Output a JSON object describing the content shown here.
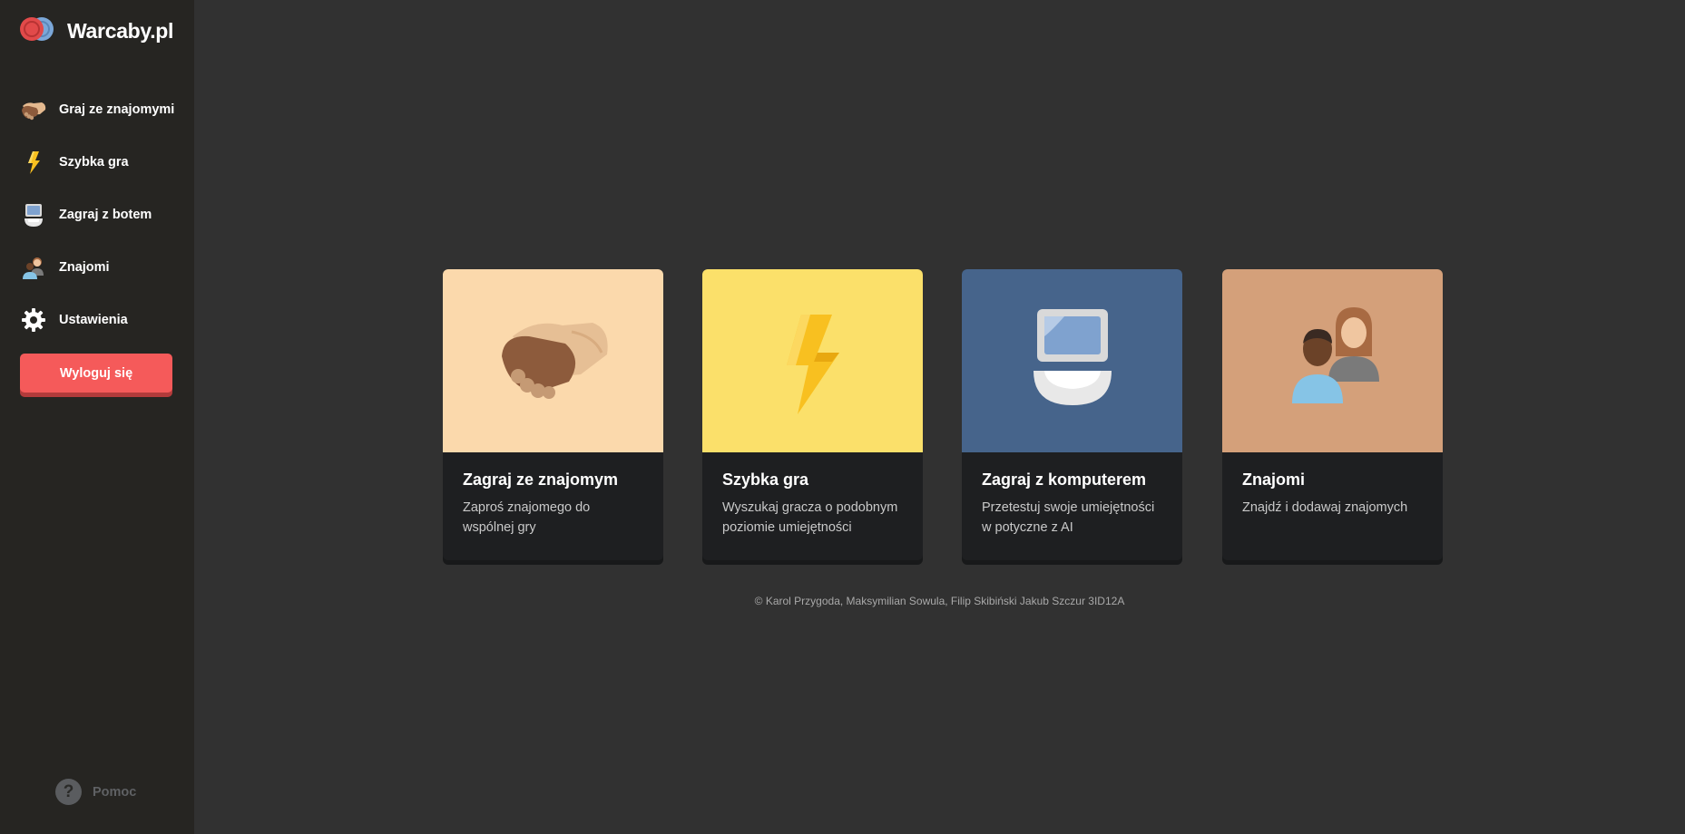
{
  "app": {
    "name": "Warcaby.pl"
  },
  "colors": {
    "accent": "#f55a5a",
    "sidebar": "#262522",
    "background": "#313131"
  },
  "sidebar": {
    "items": [
      {
        "label": "Graj ze znajomymi",
        "icon": "handshake-icon"
      },
      {
        "label": "Szybka gra",
        "icon": "lightning-icon"
      },
      {
        "label": "Zagraj z botem",
        "icon": "computer-icon"
      },
      {
        "label": "Znajomi",
        "icon": "friends-icon"
      },
      {
        "label": "Ustawienia",
        "icon": "gear-icon"
      }
    ],
    "logout_label": "Wyloguj się",
    "help_label": "Pomoc",
    "help_glyph": "?"
  },
  "cards": [
    {
      "title": "Zagraj ze znajomym",
      "description": "Zaproś znajomego do wspólnej gry",
      "icon": "handshake-icon",
      "color": "#fbd9ac"
    },
    {
      "title": "Szybka gra",
      "description": "Wyszukaj gracza o podobnym poziomie umiejętności",
      "icon": "lightning-icon",
      "color": "#fbe06a"
    },
    {
      "title": "Zagraj z komputerem",
      "description": "Przetestuj swoje umiejętności w potyczne z AI",
      "icon": "computer-icon",
      "color": "#46648b"
    },
    {
      "title": "Znajomi",
      "description": "Znajdź i dodawaj znajomych",
      "icon": "friends-icon",
      "color": "#d4a07a"
    }
  ],
  "footer": {
    "text": "© Karol Przygoda, Maksymilian Sowula, Filip Skibiński Jakub Szczur 3ID12A"
  }
}
